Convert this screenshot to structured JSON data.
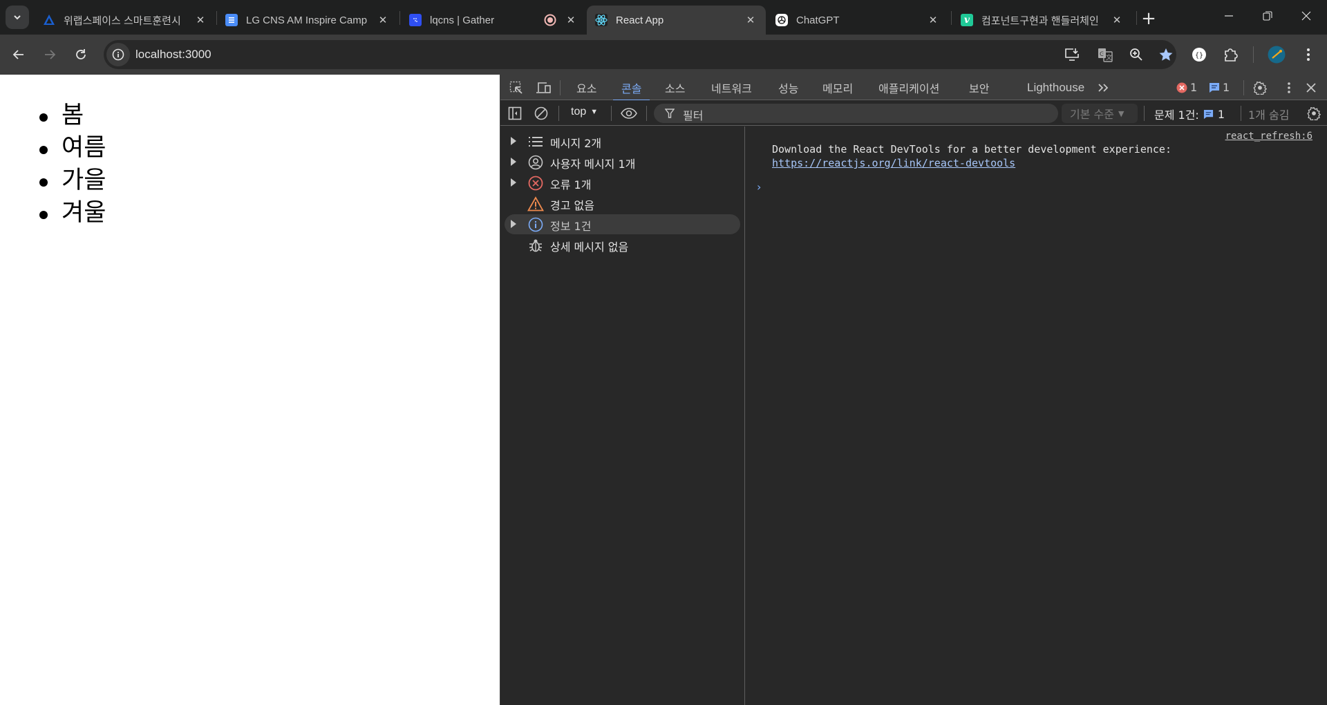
{
  "browser": {
    "tabs": [
      {
        "title": "위랩스페이스 스마트훈련시",
        "favicon": "welabspace-logo-icon",
        "active": false
      },
      {
        "title": "LG CNS AM Inspire Camp",
        "favicon": "google-docs-icon",
        "active": false
      },
      {
        "title": "lqcns | Gather",
        "favicon": "gather-icon",
        "active": false,
        "recording": true
      },
      {
        "title": "React App",
        "favicon": "react-icon",
        "active": true
      },
      {
        "title": "ChatGPT",
        "favicon": "chatgpt-icon",
        "active": false
      },
      {
        "title": "컴포넌트구현과 핸들러체인",
        "favicon": "velog-icon",
        "active": false
      }
    ],
    "new_tab_label": "+",
    "url": "localhost:3000"
  },
  "page": {
    "list_items": [
      "봄",
      "여름",
      "가을",
      "겨울"
    ]
  },
  "devtools": {
    "tabs": [
      "요소",
      "콘솔",
      "소스",
      "네트워크",
      "성능",
      "메모리",
      "애플리케이션",
      "보안",
      "Lighthouse"
    ],
    "active_tab": "콘솔",
    "error_count": "1",
    "info_count": "1",
    "console_toolbar": {
      "context": "top",
      "filter_placeholder": "필터",
      "level": "기본 수준",
      "issues_label": "문제 1건:",
      "issues_count": "1",
      "hidden_label": "1개 숨김"
    },
    "sidebar": [
      {
        "label": "메시지 2개",
        "icon": "list-icon",
        "expandable": true
      },
      {
        "label": "사용자 메시지 1개",
        "icon": "user-icon",
        "expandable": true
      },
      {
        "label": "오류 1개",
        "icon": "error-icon",
        "expandable": true
      },
      {
        "label": "경고 없음",
        "icon": "warning-icon",
        "expandable": false
      },
      {
        "label": "정보 1건",
        "icon": "info-icon",
        "expandable": true,
        "selected": true
      },
      {
        "label": "상세 메시지 없음",
        "icon": "bug-icon",
        "expandable": false
      }
    ],
    "messages": [
      {
        "source": "react_refresh:6",
        "text": "Download the React DevTools for a better development experience: ",
        "link": "https://reactjs.org/link/react-devtools"
      }
    ],
    "prompt": "›"
  },
  "colors": {
    "accent": "#7cacf8",
    "error": "#e46962",
    "warning": "#ee8a4e",
    "info": "#7cacf8",
    "link": "#a8c7fa",
    "bookmark_star": "#a8c7fa"
  }
}
